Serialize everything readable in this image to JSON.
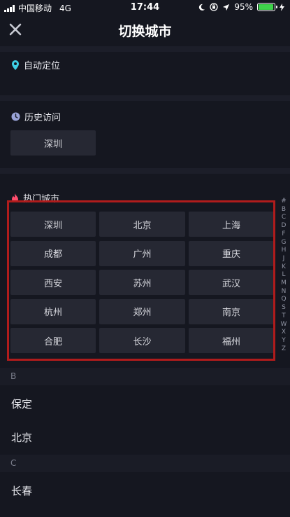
{
  "status_bar": {
    "carrier": "中国移动",
    "network": "4G",
    "time": "17:44",
    "battery": "95%",
    "battery_level": 0.95
  },
  "nav": {
    "title": "切换城市",
    "close_icon": "close-icon"
  },
  "locate": {
    "label": "自动定位",
    "icon": "location-pin-icon",
    "icon_color": "#3fd0e6"
  },
  "history": {
    "label": "历史访问",
    "icon": "clock-icon",
    "icon_color": "#9aa4d8",
    "cities": [
      "深圳"
    ]
  },
  "hot": {
    "label": "热门城市",
    "icon": "flame-icon",
    "icon_color": "#ff4d6d",
    "cities": [
      "深圳",
      "北京",
      "上海",
      "成都",
      "广州",
      "重庆",
      "西安",
      "苏州",
      "武汉",
      "杭州",
      "郑州",
      "南京",
      "合肥",
      "长沙",
      "福州"
    ]
  },
  "index_letters": [
    "#",
    "B",
    "C",
    "D",
    "F",
    "G",
    "H",
    "J",
    "K",
    "L",
    "M",
    "N",
    "Q",
    "S",
    "T",
    "W",
    "X",
    "Y",
    "Z"
  ],
  "groups": [
    {
      "letter": "B",
      "cities": [
        "保定",
        "北京"
      ]
    },
    {
      "letter": "C",
      "cities": [
        "长春"
      ]
    }
  ],
  "colors": {
    "background": "#151720",
    "chip": "#262833",
    "highlight_frame": "#b01c1c"
  }
}
